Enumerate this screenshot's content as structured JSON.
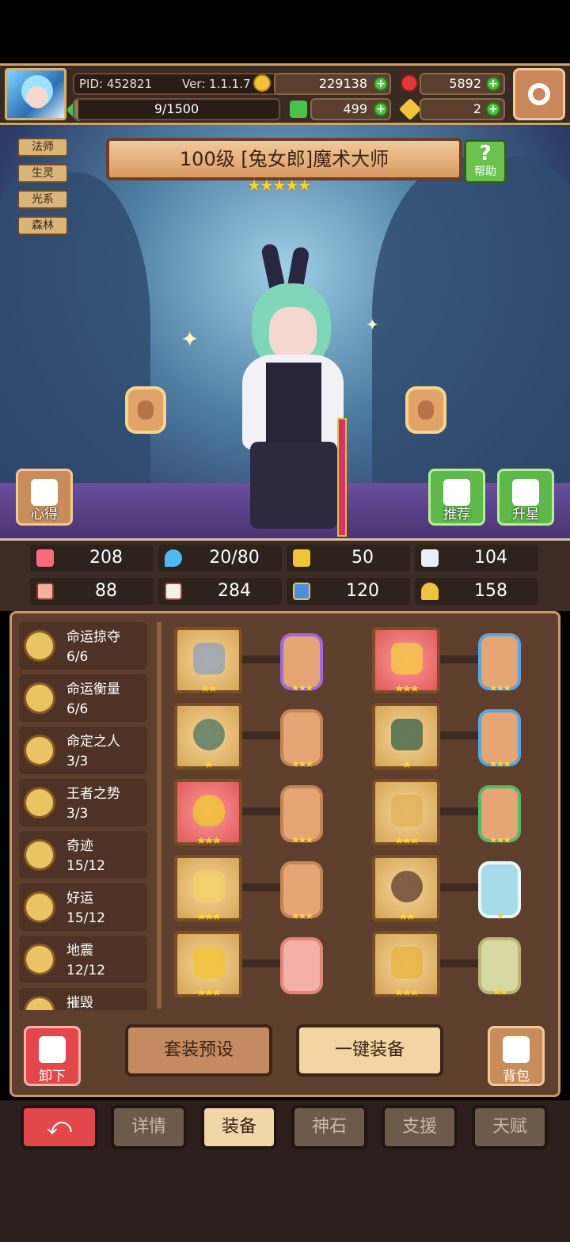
{
  "header": {
    "pid": "PID: 452821",
    "version": "Ver: 1.1.1.7",
    "gold": "229138",
    "gems": "5892",
    "energy": "9/1500",
    "energy_fill": 0.006,
    "clover": "499",
    "keys": "2",
    "plus": "+"
  },
  "tags": [
    "法师",
    "生灵",
    "光系",
    "森林"
  ],
  "hero": {
    "title": "100级  [兔女郎]魔术大师",
    "stars": "★★★★★",
    "help_label": "帮助",
    "help_icon": "?"
  },
  "buttons": {
    "insight": "心得",
    "recommend": "推荐",
    "star_up": "升星",
    "unequip": "卸下",
    "preset": "套装预设",
    "auto_equip": "一键装备",
    "bag": "背包"
  },
  "stats": {
    "hp": "208",
    "mana": "20/80",
    "defense": "50",
    "speed": "104",
    "attack": "88",
    "magic": "284",
    "resist": "120",
    "luck": "158"
  },
  "sets": [
    {
      "name": "命运掠夺",
      "count": "6/6"
    },
    {
      "name": "命运衡量",
      "count": "6/6"
    },
    {
      "name": "命定之人",
      "count": "3/3"
    },
    {
      "name": "王者之势",
      "count": "3/3"
    },
    {
      "name": "奇迹",
      "count": "15/12"
    },
    {
      "name": "好运",
      "count": "15/12"
    },
    {
      "name": "地震",
      "count": "12/12"
    },
    {
      "name": "摧毁",
      "count": ""
    }
  ],
  "equipment": {
    "stars3": "★★★",
    "stars2": "★★",
    "stars1": "★"
  },
  "tabs": [
    "详情",
    "装备",
    "神石",
    "支援",
    "天赋"
  ],
  "colors": {
    "accent_red": "#e2474b",
    "tab_active": "#f1d6aa",
    "tab_inactive": "#6c5a4a",
    "panel": "#5e3f2e"
  }
}
